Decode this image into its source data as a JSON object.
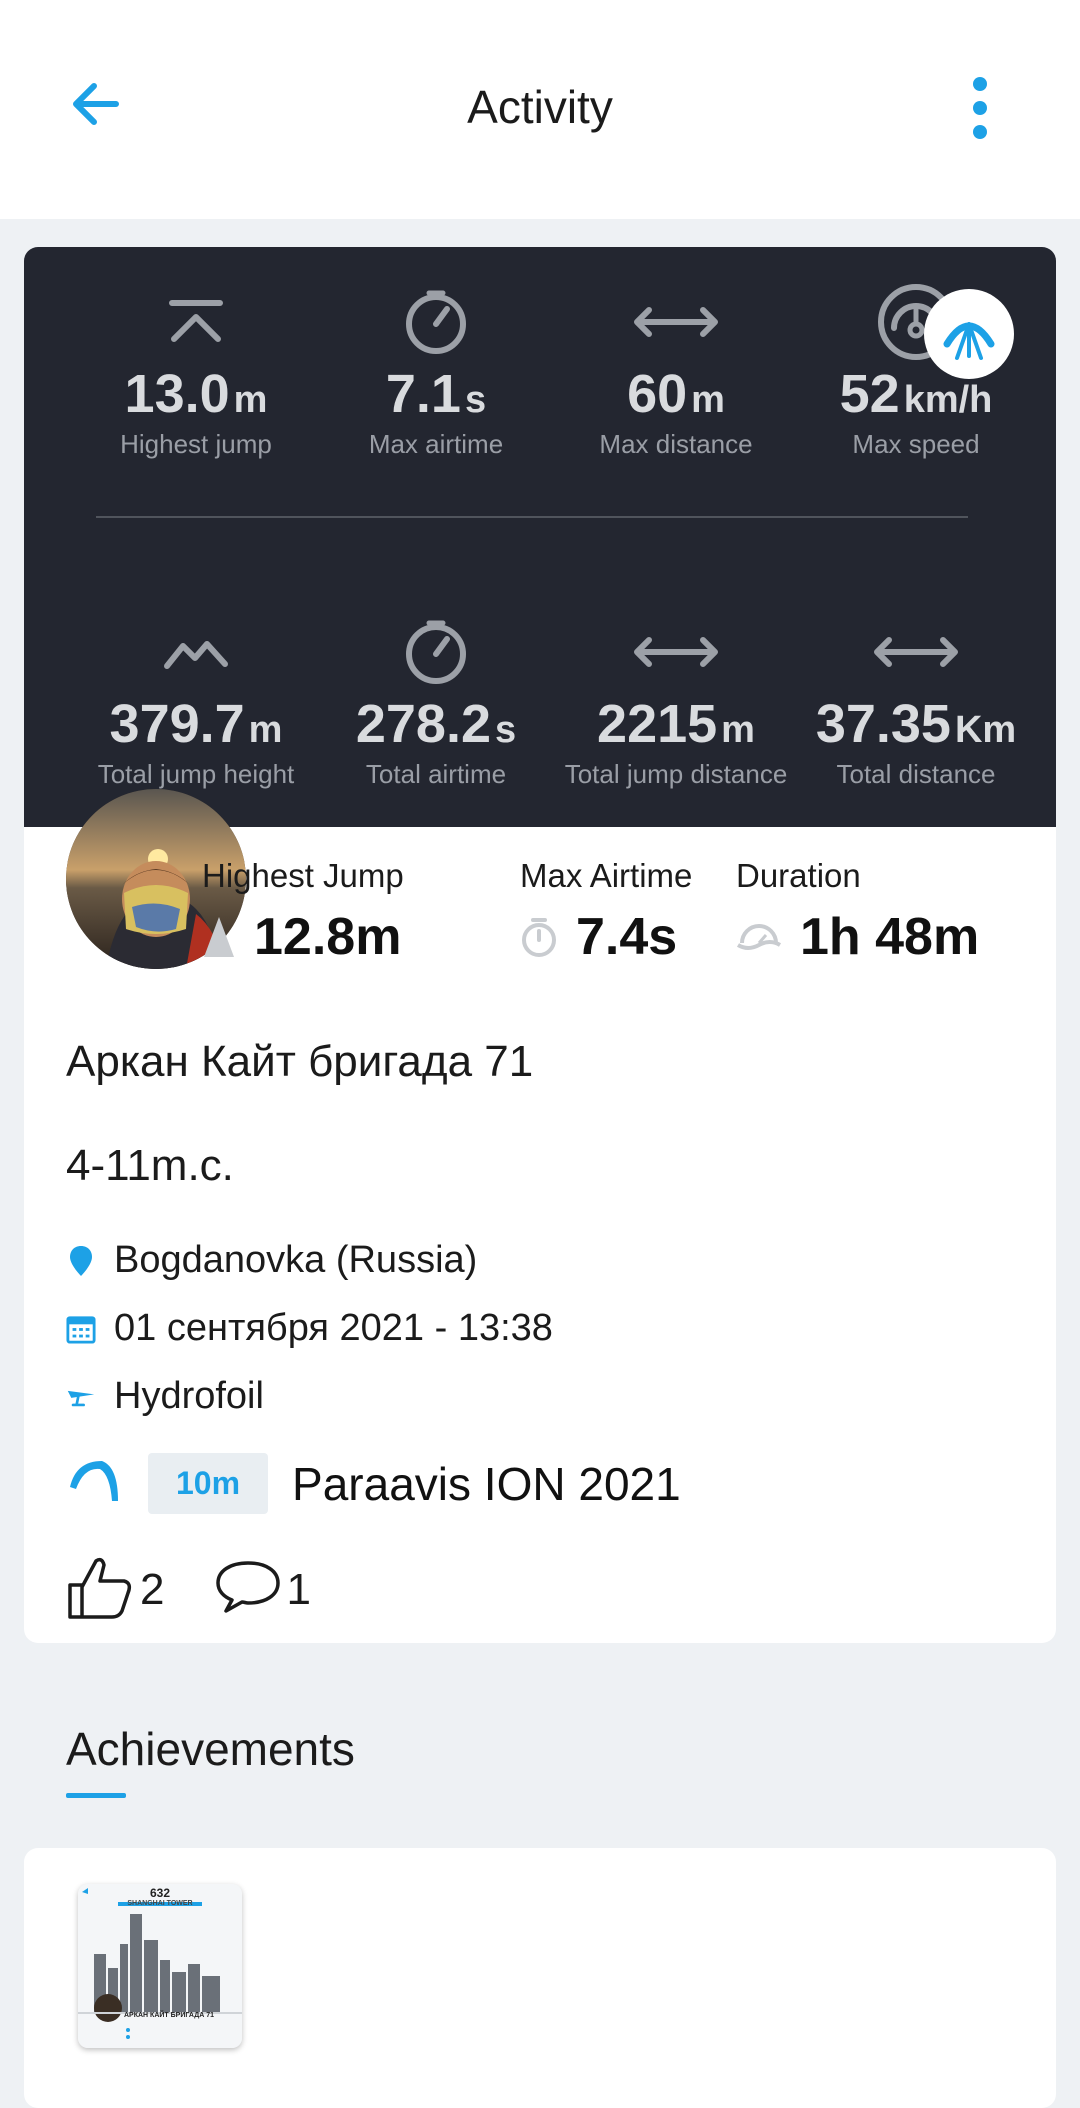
{
  "appbar": {
    "title": "Activity"
  },
  "stats": {
    "row1": [
      {
        "icon": "highest-jump-icon",
        "value": "13.0",
        "unit": "m",
        "label": "Highest jump"
      },
      {
        "icon": "stopwatch-icon",
        "value": "7.1",
        "unit": "s",
        "label": "Max airtime"
      },
      {
        "icon": "distance-arrows-icon",
        "value": "60",
        "unit": "m",
        "label": "Max distance"
      },
      {
        "icon": "speedometer-icon",
        "value": "52",
        "unit": "km/h",
        "label": "Max speed"
      }
    ],
    "row2": [
      {
        "icon": "total-jump-height-icon",
        "value": "379.7",
        "unit": "m",
        "label": "Total jump height"
      },
      {
        "icon": "stopwatch-icon",
        "value": "278.2",
        "unit": "s",
        "label": "Total airtime"
      },
      {
        "icon": "distance-arrows-icon",
        "value": "2215",
        "unit": "m",
        "label": "Total jump distance"
      },
      {
        "icon": "distance-arrows-icon",
        "value": "37.35",
        "unit": "Km",
        "label": "Total distance"
      }
    ]
  },
  "kpis": [
    {
      "label": "Highest Jump",
      "value": "12.8m",
      "icon": "jump-triangle-icon"
    },
    {
      "label": "Max Airtime",
      "value": "7.4s",
      "icon": "stopwatch-icon"
    },
    {
      "label": "Duration",
      "value": "1h 48m",
      "icon": "duration-icon"
    }
  ],
  "session": {
    "title": "Аркан Кайт бригада 71",
    "description": "4-11m.c.",
    "location": "Bogdanovka (Russia)",
    "datetime": "01 сентября 2021 - 13:38",
    "discipline": "Hydrofoil",
    "kite_size": "10m",
    "kite_name": "Paraavis ION 2021"
  },
  "social": {
    "likes": "2",
    "comments": "1"
  },
  "achievements": {
    "title": "Achievements",
    "thumb_number": "632",
    "thumb_subtitle": "SHANGHAI TOWER",
    "thumb_name": "АРКАН КАЙТ БРИГАДА 71"
  },
  "colors": {
    "accent": "#1da1e6",
    "dark_card": "#232630",
    "background": "#eef1f4"
  }
}
